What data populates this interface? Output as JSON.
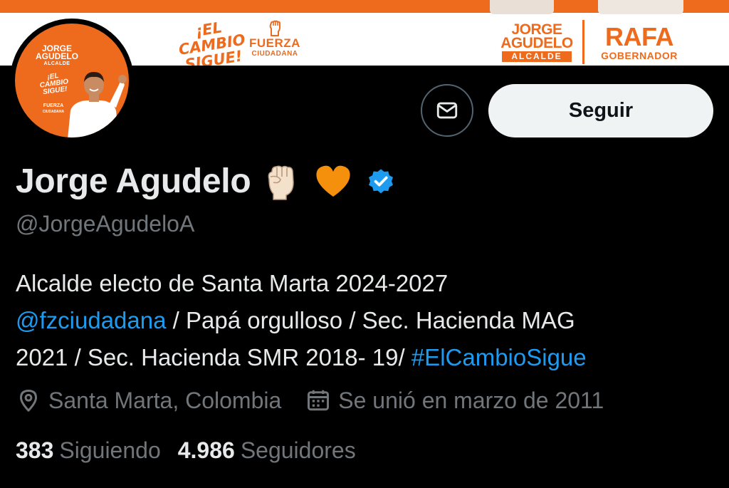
{
  "banner": {
    "slogan_line1": "¡EL",
    "slogan_line2": "CAMBIO",
    "slogan_line3": "SIGUE!",
    "party_name": "FUERZA",
    "party_sub": "CIUDADANA",
    "candidate1_first": "JORGE",
    "candidate1_last": "AGUDELO",
    "candidate1_role": "ALCALDE",
    "candidate2_name": "RAFA",
    "candidate2_role": "GOBERNADOR",
    "accent_color": "#ee6a1d"
  },
  "avatar": {
    "name_first": "JORGE",
    "name_last": "AGUDELO",
    "role": "ALCALDE",
    "slogan_line1": "¡EL",
    "slogan_line2": "CAMBIO",
    "slogan_line3": "SIGUE!",
    "party_line1": "FUERZA",
    "party_line2": "CIUDADANA"
  },
  "actions": {
    "message_icon": "envelope-icon",
    "follow_label": "Seguir"
  },
  "profile": {
    "display_name": "Jorge Agudelo",
    "name_emojis": [
      "raised-fist-icon",
      "orange-heart-icon"
    ],
    "verified_icon": "verified-badge-icon",
    "handle": "@JorgeAgudeloA",
    "bio": {
      "line1": "Alcalde electo de Santa Marta 2024-2027",
      "mention": "@fzciudadana",
      "line2_rest": " / Papá orgulloso / Sec. Hacienda MAG",
      "line3_start": "2021 / Sec. Hacienda SMR 2018- 19/ ",
      "hashtag": "#ElCambioSigue"
    },
    "location": "Santa Marta, Colombia",
    "joined": "Se unió en marzo de 2011",
    "following_count": "383",
    "following_label": "Siguiendo",
    "followers_count": "4.986",
    "followers_label": "Seguidores"
  },
  "colors": {
    "background": "#000000",
    "primary_text": "#e7e9ea",
    "secondary_text": "#71767b",
    "link": "#1d9bf0",
    "follow_button_bg": "#eff3f4"
  }
}
